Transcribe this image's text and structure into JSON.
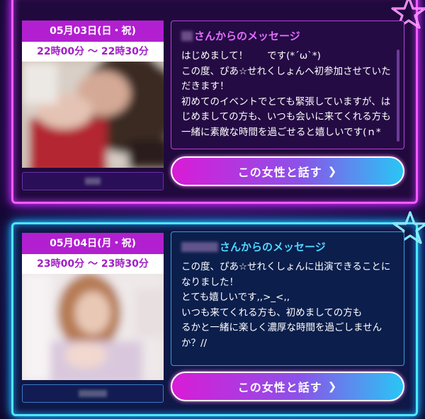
{
  "cards": [
    {
      "date": "05月03日(日・祝)",
      "time": "22時00分 ～ 22時30分",
      "message_title": "さんからのメッセージ",
      "message_body": "はじめまして！　　です(*´ω`*)\nこの度、ぴあ☆せれくしょんへ初参加させていただきます！\n初めてのイベントでとても緊張していますが、はじめましての方も、いつも会いに来てくれる方も一緒に素敵な時間を過ごせると嬉しいです(ｎ*´ω`*ｎ)",
      "button_label": "この女性と話す",
      "accent": "#f25cff"
    },
    {
      "date": "05月04日(月・祝)",
      "time": "23時00分 ～ 23時30分",
      "message_title": "さんからのメッセージ",
      "message_body": "この度、ぴあ☆せれくしょんに出演できることになりました！\nとても嬉しいです,,>_<,,\nいつも来てくれる方も、初めましての方も\nるかと一緒に楽しく濃厚な時間を過ごしませんか？//",
      "button_label": "この女性と話す",
      "accent": "#4ee6ff"
    }
  ],
  "icons": {
    "star": "star-icon",
    "chevron": "chevron-right-icon"
  }
}
